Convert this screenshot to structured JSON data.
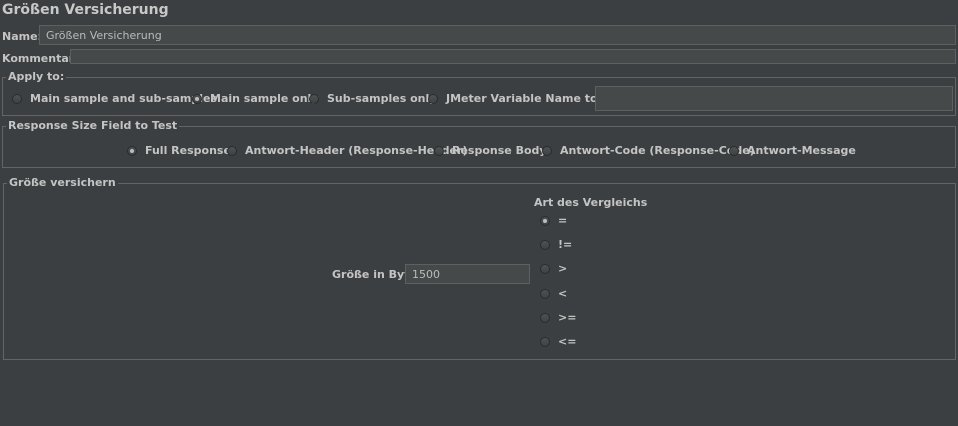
{
  "title": "Größen Versicherung",
  "name_label": "Name:",
  "name_value": "Größen Versicherung",
  "comments_label": "Kommentare:",
  "apply_to": {
    "legend": "Apply to:",
    "options": [
      "Main sample and sub-samples",
      "Main sample only",
      "Sub-samples only",
      "JMeter Variable Name to use"
    ],
    "selected": "Main sample only",
    "variable_value": ""
  },
  "response_field": {
    "legend": "Response Size Field to Test",
    "options": [
      "Full Response",
      "Antwort-Header (Response-Header)",
      "Response Body",
      "Antwort-Code (Response-Code)",
      "Antwort-Message"
    ],
    "selected": "Full Response"
  },
  "size_assert": {
    "legend": "Größe versichern",
    "size_label": "Größe in Byte:",
    "size_value": "1500",
    "comparison_title": "Art des Vergleichs",
    "operators": [
      "=",
      "!=",
      ">",
      "<",
      ">=",
      "<="
    ],
    "selected": "="
  }
}
